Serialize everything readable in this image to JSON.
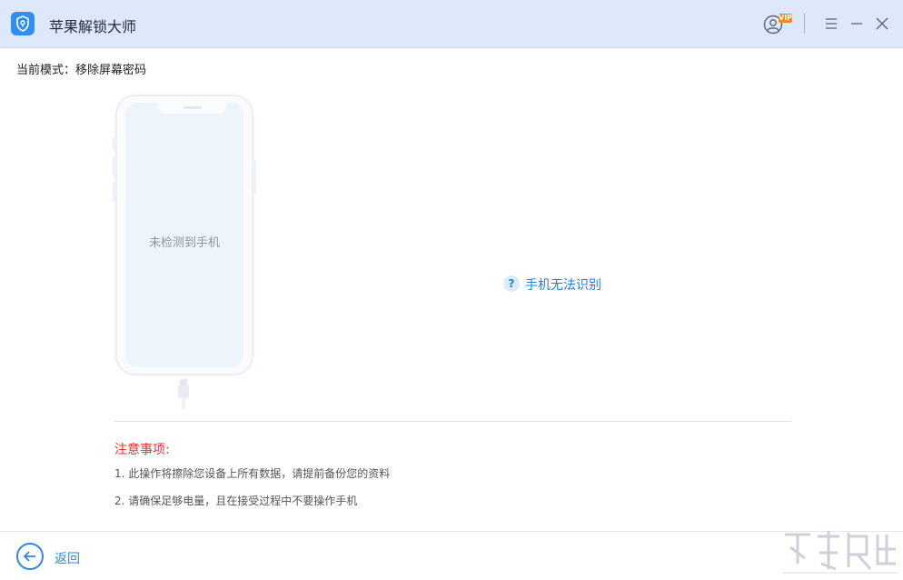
{
  "app": {
    "title": "苹果解锁大师"
  },
  "titlebar": {
    "vip_badge": "VIP"
  },
  "mode": {
    "label": "当前模式：移除屏幕密码"
  },
  "device": {
    "status_text": "未检测到手机"
  },
  "help": {
    "link_text": "手机无法识别"
  },
  "notes": {
    "title": "注意事项:",
    "items": [
      "1. 此操作将擦除您设备上所有数据，请提前备份您的资料",
      "2. 请确保足够电量，且在接受过程中不要操作手机"
    ]
  },
  "footer": {
    "back_label": "返回"
  },
  "colors": {
    "accent": "#2f86e8",
    "titlebar": "#dde8fb",
    "warning": "#e0323a",
    "vip": "#f08a24"
  },
  "icons": [
    "shield-lock-icon",
    "user-icon",
    "menu-icon",
    "minimize-icon",
    "close-icon",
    "question-icon",
    "back-arrow-icon",
    "lightning-cable-icon"
  ]
}
